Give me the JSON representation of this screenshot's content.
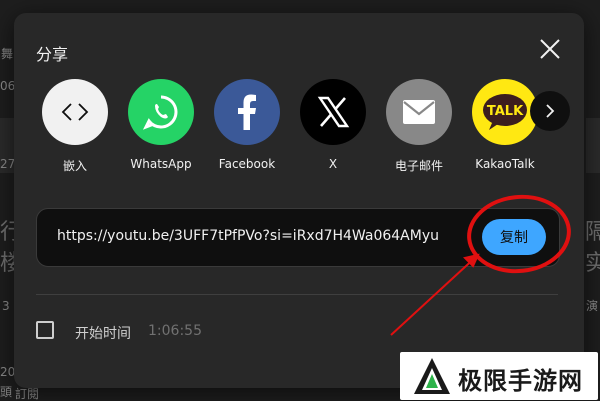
{
  "modal": {
    "title": "分享",
    "close_icon": "close-icon"
  },
  "share_targets": [
    {
      "label": "嵌入",
      "icon": "embed-icon",
      "color": "#f1f1f1"
    },
    {
      "label": "WhatsApp",
      "icon": "whatsapp-icon",
      "color": "#25d366"
    },
    {
      "label": "Facebook",
      "icon": "facebook-icon",
      "color": "#3b5998"
    },
    {
      "label": "X",
      "icon": "x-icon",
      "color": "#000000"
    },
    {
      "label": "电子邮件",
      "icon": "email-icon",
      "color": "#888888"
    },
    {
      "label": "KakaoTalk",
      "icon": "kakaotalk-icon",
      "color": "#ffe812"
    }
  ],
  "kakaotalk_logo_text": "TALK",
  "next_icon": "chevron-right-icon",
  "link": {
    "url": "https://youtu.be/3UFF7tPfPVo?si=iRxd7H4Wa064AMyu",
    "copy_label": "复制",
    "copy_color": "#3ea6ff"
  },
  "start_at": {
    "label": "开始时间",
    "time": "1:06:55",
    "checked": false
  },
  "background_fragments": [
    "舞",
    "06",
    "27",
    "行",
    "楼",
    "3",
    "20",
    "頭",
    "隔",
    "实",
    "演",
    "訂閱"
  ],
  "annotation_color": "#e01010",
  "watermark": {
    "text": "极限手游网"
  }
}
